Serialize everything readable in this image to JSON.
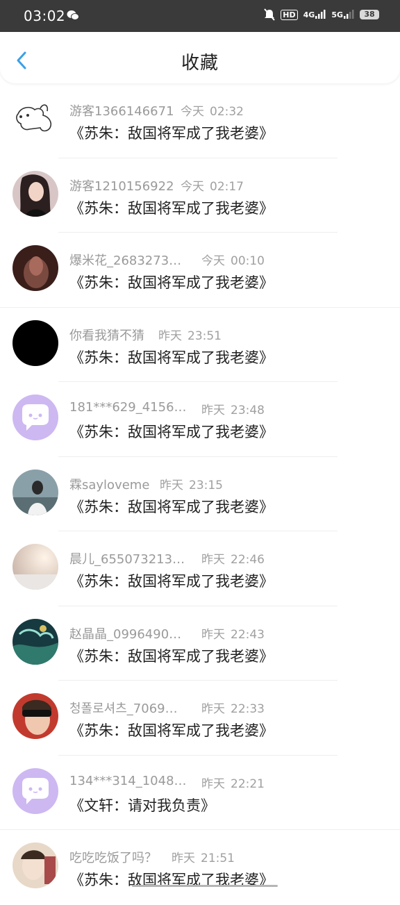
{
  "status_bar": {
    "time": "03:02",
    "network_4g": "4G",
    "network_5g": "5G",
    "battery": "38",
    "hd": "HD"
  },
  "header": {
    "title": "收藏",
    "back_icon": "chevron-left-icon"
  },
  "colors": {
    "accent": "#3aa0e8",
    "status_bg": "#3a3a3a",
    "placeholder_avatar": "#c9b6f0"
  },
  "items": [
    {
      "user": "游客1366146671",
      "day": "今天",
      "clock": "02:32",
      "book": "《苏朱：敌国将军成了我老婆》",
      "avatar": "dog-sketch"
    },
    {
      "user": "游客1210156922",
      "day": "今天",
      "clock": "02:17",
      "book": "《苏朱：敌国将军成了我老婆》",
      "avatar": "photo-woman"
    },
    {
      "user": "爆米花_2683273…",
      "day": "今天",
      "clock": "00:10",
      "book": "《苏朱：敌国将军成了我老婆》",
      "avatar": "photo-dark"
    },
    {
      "user": "你看我猜不猜",
      "day": "昨天",
      "clock": "23:51",
      "book": "《苏朱：敌国将军成了我老婆》",
      "avatar": "black"
    },
    {
      "user": "181***629_4156…",
      "day": "昨天",
      "clock": "23:48",
      "book": "《苏朱：敌国将军成了我老婆》",
      "avatar": "chat-placeholder"
    },
    {
      "user": "霖sayloveme",
      "day": "昨天",
      "clock": "23:15",
      "book": "《苏朱：敌国将军成了我老婆》",
      "avatar": "photo-boy"
    },
    {
      "user": "晨儿_655073213…",
      "day": "昨天",
      "clock": "22:46",
      "book": "《苏朱：敌国将军成了我老婆》",
      "avatar": "photo-beige"
    },
    {
      "user": "赵晶晶_0996490…",
      "day": "昨天",
      "clock": "22:43",
      "book": "《苏朱：敌国将军成了我老婆》",
      "avatar": "photo-teal"
    },
    {
      "user": "청폴로셔츠_7069…",
      "day": "昨天",
      "clock": "22:33",
      "book": "《苏朱：敌国将军成了我老婆》",
      "avatar": "photo-sunglasses"
    },
    {
      "user": "134***314_1048…",
      "day": "昨天",
      "clock": "22:21",
      "book": "《文轩：请对我负责》",
      "avatar": "chat-placeholder"
    },
    {
      "user": "吃吃吃饭了吗？",
      "day": "昨天",
      "clock": "21:51",
      "book": "《苏朱：敌国将军成了我老婆》",
      "avatar": "photo-cartoon"
    }
  ]
}
